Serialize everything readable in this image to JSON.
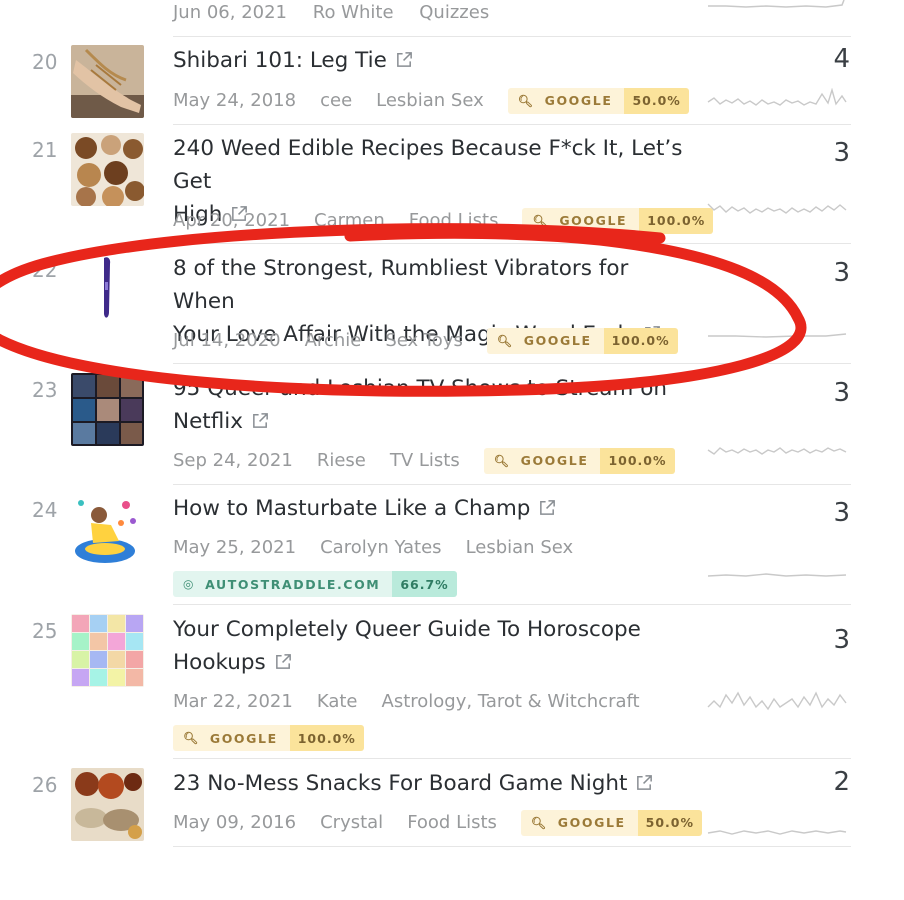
{
  "top_row": {
    "date": "Jun 06, 2021",
    "author": "Ro White",
    "category": "Quizzes"
  },
  "rows": [
    {
      "rank": "20",
      "title_lines": [
        "Shibari 101: Leg Tie"
      ],
      "date": "May 24, 2018",
      "author": "cee",
      "category": "Lesbian Sex",
      "source": "GOOGLE",
      "percent": "50.0%",
      "count": "4",
      "thumb": "legs-photo"
    },
    {
      "rank": "21",
      "title_lines": [
        "240 Weed Edible Recipes Because F*ck It, Let’s Get",
        "High"
      ],
      "date": "Apr 20, 2021",
      "author": "Carmen",
      "category": "Food Lists",
      "source": "GOOGLE",
      "percent": "100.0%",
      "count": "3",
      "thumb": "cookies-photo"
    },
    {
      "rank": "22",
      "title_lines": [
        "8 of the Strongest, Rumbliest Vibrators for When",
        "Your Love Affair With the Magic Wand Ends"
      ],
      "date": "Jul 14, 2020",
      "author": "Archie",
      "category": "Sex Toys",
      "source": "GOOGLE",
      "percent": "100.0%",
      "count": "3",
      "thumb": "vibrator-photo"
    },
    {
      "rank": "23",
      "title_lines": [
        "95 Queer and Lesbian TV Shows to Stream on",
        "Netflix"
      ],
      "date": "Sep 24, 2021",
      "author": "Riese",
      "category": "TV Lists",
      "source": "GOOGLE",
      "percent": "100.0%",
      "count": "3",
      "thumb": "tv-collage-photo"
    },
    {
      "rank": "24",
      "title_lines": [
        "How to Masturbate Like a Champ"
      ],
      "date": "May 25, 2021",
      "author": "Carolyn Yates",
      "category": "Lesbian Sex",
      "source": "AUTOSTRADDLE.COM",
      "percent": "66.7%",
      "count": "3",
      "thumb": "illustration"
    },
    {
      "rank": "25",
      "title_lines": [
        "Your Completely Queer Guide To Horoscope",
        "Hookups"
      ],
      "date": "Mar 22, 2021",
      "author": "Kate",
      "category": "Astrology, Tarot & Witchcraft",
      "source": "GOOGLE",
      "percent": "100.0%",
      "count": "3",
      "thumb": "horoscope-grid"
    },
    {
      "rank": "26",
      "title_lines": [
        "23 No-Mess Snacks For Board Game Night"
      ],
      "date": "May 09, 2016",
      "author": "Crystal",
      "category": "Food Lists",
      "source": "GOOGLE",
      "percent": "50.0%",
      "count": "2",
      "thumb": "snacks-photo"
    }
  ],
  "colors": {
    "google_badge": "#fbe39b",
    "site_badge": "#b9eadb",
    "highlight_oval": "#e8261b"
  },
  "icons": {
    "search": "search-icon",
    "site": "target-icon",
    "external": "external-link-icon"
  }
}
